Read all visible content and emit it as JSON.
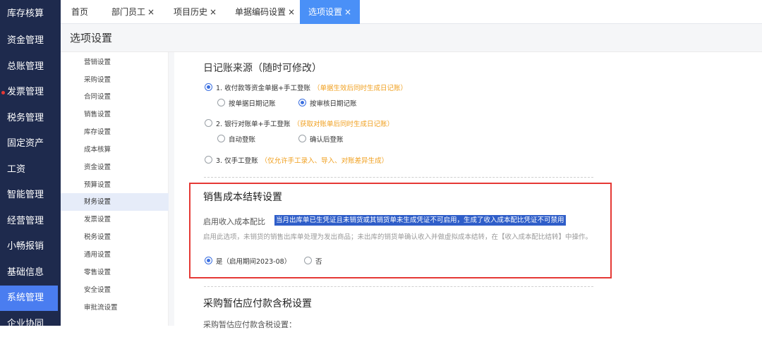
{
  "sidebar": {
    "items": [
      {
        "label": "库存核算"
      },
      {
        "label": "资金管理"
      },
      {
        "label": "总账管理"
      },
      {
        "label": "发票管理",
        "dot": true
      },
      {
        "label": "税务管理"
      },
      {
        "label": "固定资产"
      },
      {
        "label": "工资"
      },
      {
        "label": "智能管理"
      },
      {
        "label": "经营管理"
      },
      {
        "label": "小畅报销"
      },
      {
        "label": "基础信息"
      },
      {
        "label": "系统管理",
        "active": true
      },
      {
        "label": "企业协同"
      }
    ]
  },
  "tabs": [
    {
      "label": "首页",
      "closable": false
    },
    {
      "label": "部门员工",
      "closable": true
    },
    {
      "label": "项目历史",
      "closable": true
    },
    {
      "label": "单据编码设置",
      "closable": true
    },
    {
      "label": "选项设置",
      "closable": true,
      "active": true
    }
  ],
  "close_glyph": "×",
  "page_title": "选项设置",
  "submenu": {
    "items": [
      {
        "label": "营销设置"
      },
      {
        "label": "采购设置"
      },
      {
        "label": "合同设置"
      },
      {
        "label": "销售设置"
      },
      {
        "label": "库存设置"
      },
      {
        "label": "成本核算"
      },
      {
        "label": "资金设置"
      },
      {
        "label": "预算设置"
      },
      {
        "label": "财务设置",
        "active": true
      },
      {
        "label": "发票设置"
      },
      {
        "label": "税务设置"
      },
      {
        "label": "通用设置"
      },
      {
        "label": "零售设置"
      },
      {
        "label": "安全设置"
      },
      {
        "label": "审批流设置"
      }
    ]
  },
  "journal": {
    "title": "日记账来源（随时可修改）",
    "options": [
      {
        "label": "1. 收付款等资金单据+手工登账",
        "hint": "（单据生效后同时生成日记账）",
        "checked": true
      },
      {
        "label": "2. 银行对账单+手工登账",
        "hint": "（获取对账单后同时生成日记账）",
        "checked": false
      },
      {
        "label": "3. 仅手工登账",
        "hint": "（仅允许手工录入、导入、对账差异生成）",
        "checked": false
      }
    ],
    "sub1": [
      {
        "label": "按单据日期记账",
        "checked": false
      },
      {
        "label": "按审核日期记账",
        "checked": true
      }
    ],
    "sub2": [
      {
        "label": "自动登账",
        "checked": false
      },
      {
        "label": "确认后登账",
        "checked": false
      }
    ]
  },
  "cost": {
    "title": "销售成本结转设置",
    "enable_label": "启用收入成本配比",
    "highlight": "当月出库单已生凭证且未销货或其销货单未生成凭证不可启用，生成了收入成本配比凭证不可禁用",
    "desc": "启用此选项，未销货的销售出库单处理为发出商品；未出库的销货单确认收入并做虚拟成本结转，在【收入成本配比结转】中操作。",
    "yes": "是（启用期间2023-08）",
    "no": "否",
    "selected": "yes"
  },
  "purchase": {
    "title": "采购暂估应付款含税设置",
    "sub": "采购暂估应付款含税设置："
  },
  "colors": {
    "nav_bg": "#1e2a4d",
    "accent": "#4a7df0",
    "highlight_bg": "#2f5ec9",
    "hint": "#f0a020",
    "red_box": "#e53935"
  }
}
